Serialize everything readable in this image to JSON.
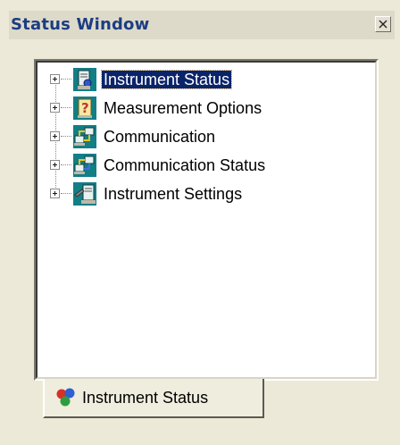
{
  "window": {
    "title": "Status Window",
    "close_symbol": "×"
  },
  "tree": {
    "items": [
      {
        "label": "Instrument Status",
        "icon": "instrument-status-icon",
        "selected": true
      },
      {
        "label": "Measurement Options",
        "icon": "measurement-options-icon",
        "selected": false
      },
      {
        "label": "Communication",
        "icon": "communication-icon",
        "selected": false
      },
      {
        "label": "Communication Status",
        "icon": "communication-status-icon",
        "selected": false
      },
      {
        "label": "Instrument Settings",
        "icon": "instrument-settings-icon",
        "selected": false
      }
    ]
  },
  "tabs": [
    {
      "label": "Instrument Status",
      "icon": "colored-dots-icon",
      "active": true
    }
  ],
  "colors": {
    "title_text": "#1c3d82",
    "selection_bg": "#0a246a",
    "icon_teal": "#127e85"
  }
}
